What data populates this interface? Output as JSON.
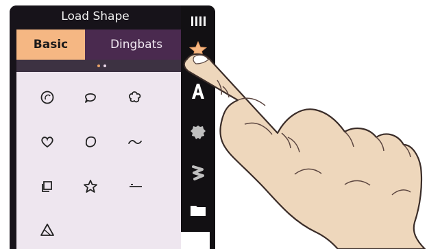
{
  "header": {
    "title": "Load Shape",
    "menu_icon": "menu-bars-icon"
  },
  "tabs": [
    {
      "label": "Basic",
      "active": true
    },
    {
      "label": "Dingbats",
      "active": false
    }
  ],
  "pager": {
    "current": 1,
    "total": 2
  },
  "shapes": [
    "circle-swirl-icon",
    "speech-bubble-icon",
    "flower-outline-icon",
    "heart-icon",
    "blob-circle-icon",
    "wave-icon",
    "square-fold-icon",
    "star-icon",
    "dash-lines-icon",
    "triangle-icon"
  ],
  "toolbar": {
    "items": [
      "shape-star-icon",
      "text-a-icon",
      "settings-gear-icon",
      "zigzag-icon",
      "folder-icon"
    ],
    "active_color": "#f5b783"
  },
  "colors": {
    "panel_bg": "#17131a",
    "tab_bg": "#4a2a4f",
    "grid_bg": "#eee6ef",
    "accent": "#f5b783"
  }
}
